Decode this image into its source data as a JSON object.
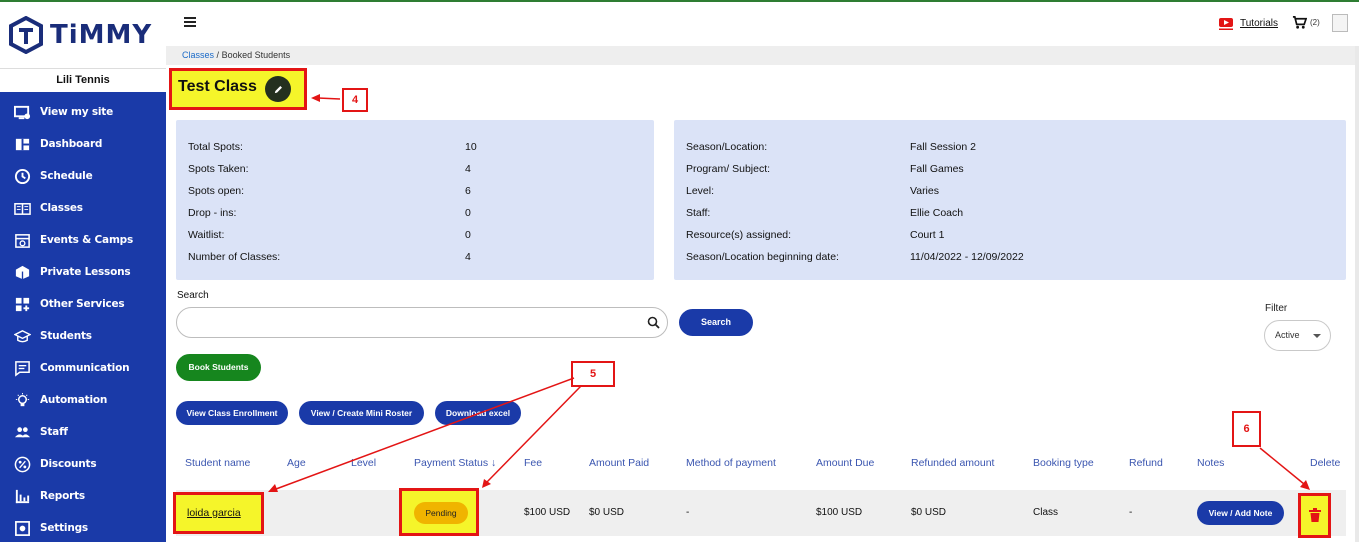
{
  "brand": {
    "name": "TiMMY",
    "account": "Lili Tennis"
  },
  "sidebar": {
    "items": [
      {
        "label": "View my site",
        "icon": "monitor-icon"
      },
      {
        "label": "Dashboard",
        "icon": "dashboard-icon"
      },
      {
        "label": "Schedule",
        "icon": "clock-icon"
      },
      {
        "label": "Classes",
        "icon": "book-icon"
      },
      {
        "label": "Events & Camps",
        "icon": "calendar-icon"
      },
      {
        "label": "Private Lessons",
        "icon": "box-icon"
      },
      {
        "label": "Other Services",
        "icon": "grid-plus-icon"
      },
      {
        "label": "Students",
        "icon": "graduation-cap-icon"
      },
      {
        "label": "Communication",
        "icon": "message-icon"
      },
      {
        "label": "Automation",
        "icon": "bulb-icon"
      },
      {
        "label": "Staff",
        "icon": "people-icon"
      },
      {
        "label": "Discounts",
        "icon": "percent-icon"
      },
      {
        "label": "Reports",
        "icon": "bar-chart-icon"
      },
      {
        "label": "Settings",
        "icon": "settings-icon"
      }
    ]
  },
  "topbar": {
    "tutorials": "Tutorials",
    "cart_count": "(2)"
  },
  "breadcrumb": {
    "parent": "Classes",
    "separator": "/",
    "current": "Booked Students"
  },
  "page": {
    "title": "Test Class"
  },
  "callouts": {
    "c4": "4",
    "c5": "5",
    "c6": "6"
  },
  "spots": [
    {
      "label": "Total Spots:",
      "value": "10"
    },
    {
      "label": "Spots Taken:",
      "value": "4"
    },
    {
      "label": "Spots open:",
      "value": "6"
    },
    {
      "label": "Drop - ins:",
      "value": "0"
    },
    {
      "label": "Waitlist:",
      "value": "0"
    },
    {
      "label": "Number of Classes:",
      "value": "4"
    }
  ],
  "details": [
    {
      "label": "Season/Location:",
      "value": "Fall Session 2"
    },
    {
      "label": "Program/ Subject:",
      "value": "Fall Games"
    },
    {
      "label": "Level:",
      "value": "Varies"
    },
    {
      "label": "Staff:",
      "value": "Ellie Coach"
    },
    {
      "label": "Resource(s) assigned:",
      "value": "Court 1"
    },
    {
      "label": "Season/Location beginning date:",
      "value": "11/04/2022 - 12/09/2022"
    }
  ],
  "search": {
    "label": "Search",
    "value": "",
    "button": "Search"
  },
  "filter": {
    "label": "Filter",
    "selected": "Active"
  },
  "actions": {
    "book_students": "Book Students",
    "view_enrollment": "View Class Enrollment",
    "mini_roster": "View / Create Mini Roster",
    "download_excel": "Download excel"
  },
  "table": {
    "headers": {
      "student_name": "Student name",
      "age": "Age",
      "level": "Level",
      "payment_status": "Payment Status ↓",
      "fee": "Fee",
      "amount_paid": "Amount Paid",
      "method": "Method of payment",
      "amount_due": "Amount Due",
      "refunded": "Refunded amount",
      "booking_type": "Booking type",
      "refund": "Refund",
      "notes": "Notes",
      "delete": "Delete"
    },
    "rows": [
      {
        "student_name": "loida garcia",
        "age": "",
        "level": "",
        "payment_status": "Pending",
        "fee": "$100 USD",
        "amount_paid": "$0 USD",
        "method": "-",
        "amount_due": "$100 USD",
        "refunded": "$0 USD",
        "booking_type": "Class",
        "refund": "-",
        "notes_button": "View / Add Note"
      }
    ]
  },
  "colors": {
    "sidebar": "#1a3aa8",
    "highlight": "#f5f52a",
    "annotation": "#e31515",
    "pending": "#f0b400",
    "green_button": "#16861e",
    "card": "#dbe3f7"
  }
}
